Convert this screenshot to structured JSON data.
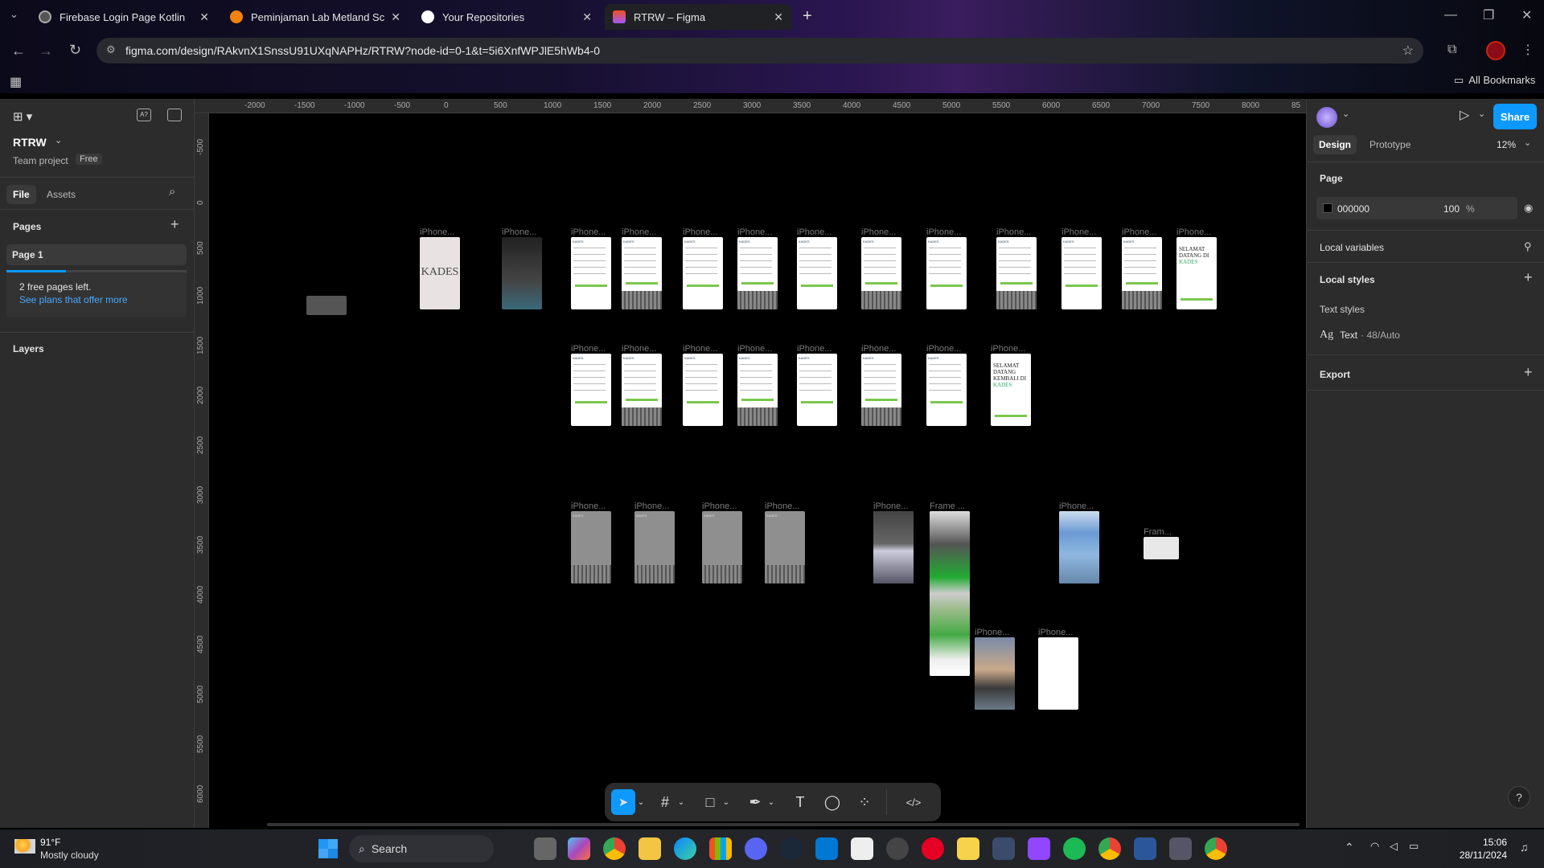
{
  "browser": {
    "tabs": [
      {
        "title": "Firebase Login Page Kotlin",
        "active": false
      },
      {
        "title": "Peminjaman Lab Metland Scho",
        "active": false
      },
      {
        "title": "Your Repositories",
        "active": false
      },
      {
        "title": "RTRW – Figma",
        "active": true
      }
    ],
    "url": "figma.com/design/RAkvnX1SnssU91UXqNAPHz/RTRW?node-id=0-1&t=5i6XnfWPJlE5hWb4-0",
    "bookmarks_label": "All Bookmarks"
  },
  "figma": {
    "file_name": "RTRW",
    "team_project": "Team project",
    "plan_badge": "Free",
    "tab_file": "File",
    "tab_assets": "Assets",
    "pages_heading": "Pages",
    "page_1": "Page 1",
    "free_pages_notice": "2 free pages left.",
    "see_plans_link": "See plans that offer more",
    "layers_heading": "Layers",
    "right": {
      "tab_design": "Design",
      "tab_prototype": "Prototype",
      "zoom": "12%",
      "share_label": "Share",
      "page_heading": "Page",
      "page_color_hex": "000000",
      "page_opacity": "100",
      "page_opacity_unit": "%",
      "local_variables": "Local variables",
      "local_styles": "Local styles",
      "text_styles": "Text styles",
      "text_style_prefix": "Ag",
      "text_style_name": "Text",
      "text_style_spec": "· 48/Auto",
      "export": "Export"
    },
    "ruler_top": [
      "-2000",
      "-1500",
      "-1000",
      "-500",
      "0",
      "500",
      "1000",
      "1500",
      "2000",
      "2500",
      "3000",
      "3500",
      "4000",
      "4500",
      "5000",
      "5500",
      "6000",
      "6500",
      "7000",
      "7500",
      "8000",
      "85"
    ],
    "ruler_left": [
      "-500",
      "0",
      "500",
      "1000",
      "1500",
      "2000",
      "2500",
      "3000",
      "3500",
      "4000",
      "4500",
      "5000",
      "5500",
      "6000"
    ],
    "frame_labels": {
      "iphone": "iPhone...",
      "frame": "Frame ...",
      "fram": "Fram..."
    },
    "frame_texts": {
      "kades": "KADES",
      "selamat1": "SELAMAT DATANG DI",
      "selamat2": "SELAMAT DATANG KEMBALI DI"
    }
  },
  "taskbar": {
    "weather_temp": "91°F",
    "weather_desc": "Mostly cloudy",
    "search_label": "Search",
    "time": "15:06",
    "date": "28/11/2024"
  },
  "colors": {
    "accent": "#0d99ff",
    "panel": "#2c2c2c",
    "green_button": "#7bc74d"
  }
}
